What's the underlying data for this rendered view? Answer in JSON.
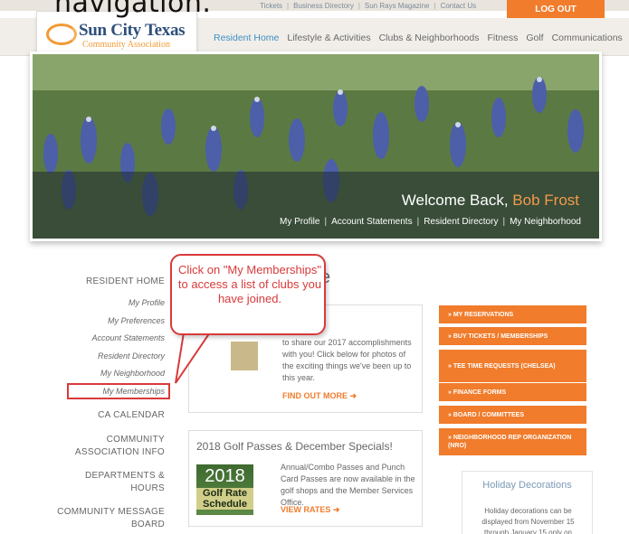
{
  "caption": "navigation.",
  "header": {
    "utility_links": [
      "Tickets",
      "Business Directory",
      "Sun Rays Magazine",
      "Contact Us"
    ],
    "logout_label": "LOG OUT",
    "logo_name": "Sun City Texas",
    "logo_sub": "Community Association",
    "nav": [
      {
        "label": "Resident Home",
        "active": true
      },
      {
        "label": "Lifestyle & Activities",
        "active": false
      },
      {
        "label": "Clubs & Neighborhoods",
        "active": false
      },
      {
        "label": "Fitness",
        "active": false
      },
      {
        "label": "Golf",
        "active": false
      },
      {
        "label": "Communications",
        "active": false
      }
    ]
  },
  "hero": {
    "welcome": "Welcome Back,",
    "user": "Bob Frost",
    "links": [
      "My Profile",
      "Account Statements",
      "Resident Directory",
      "My Neighborhood"
    ]
  },
  "sidebar": {
    "heading": "RESIDENT HOME",
    "items": [
      "My Profile",
      "My Preferences",
      "Account Statements",
      "Resident Directory",
      "My Neighborhood",
      "My Memberships"
    ],
    "sections": [
      "CA CALENDAR",
      "COMMUNITY",
      "ASSOCIATION INFO",
      "DEPARTMENTS &",
      "HOURS",
      "COMMUNITY MESSAGE",
      "BOARD"
    ]
  },
  "main": {
    "title_fragment": "e",
    "card1": {
      "text": "to share our 2017 accomplishments with you! Click below for photos of the exciting things we've been up to this year.",
      "link": "FIND OUT MORE"
    },
    "card2": {
      "title": "2018 Golf Passes & December Specials!",
      "image_year": "2018",
      "image_label_1": "Golf Rate",
      "image_label_2": "Schedule",
      "text": "Annual/Combo Passes and Punch Card Passes are now available in the golf shops and the Member Services Office.",
      "link": "VIEW RATES"
    }
  },
  "quick_links": [
    "» MY RESERVATIONS",
    "» BUY TICKETS / MEMBERSHIPS",
    "» TEE TIME REQUESTS (CHELSEA)",
    "» FINANCE FORMS",
    "» BOARD / COMMITTEES",
    "» NEIGHBORHOOD REP ORGANIZATION (NRO)"
  ],
  "holiday": {
    "title": "Holiday Decorations",
    "text": "Holiday decorations can be displayed from November 15 through January 15 only on"
  },
  "callout": {
    "text": "Click on \"My Memberships\" to access a list of clubs you have joined."
  },
  "colors": {
    "accent": "#f07c2c",
    "callout_red": "#d93a3a",
    "nav_active": "#3f8fc4",
    "logo_blue": "#2f4f7a"
  }
}
